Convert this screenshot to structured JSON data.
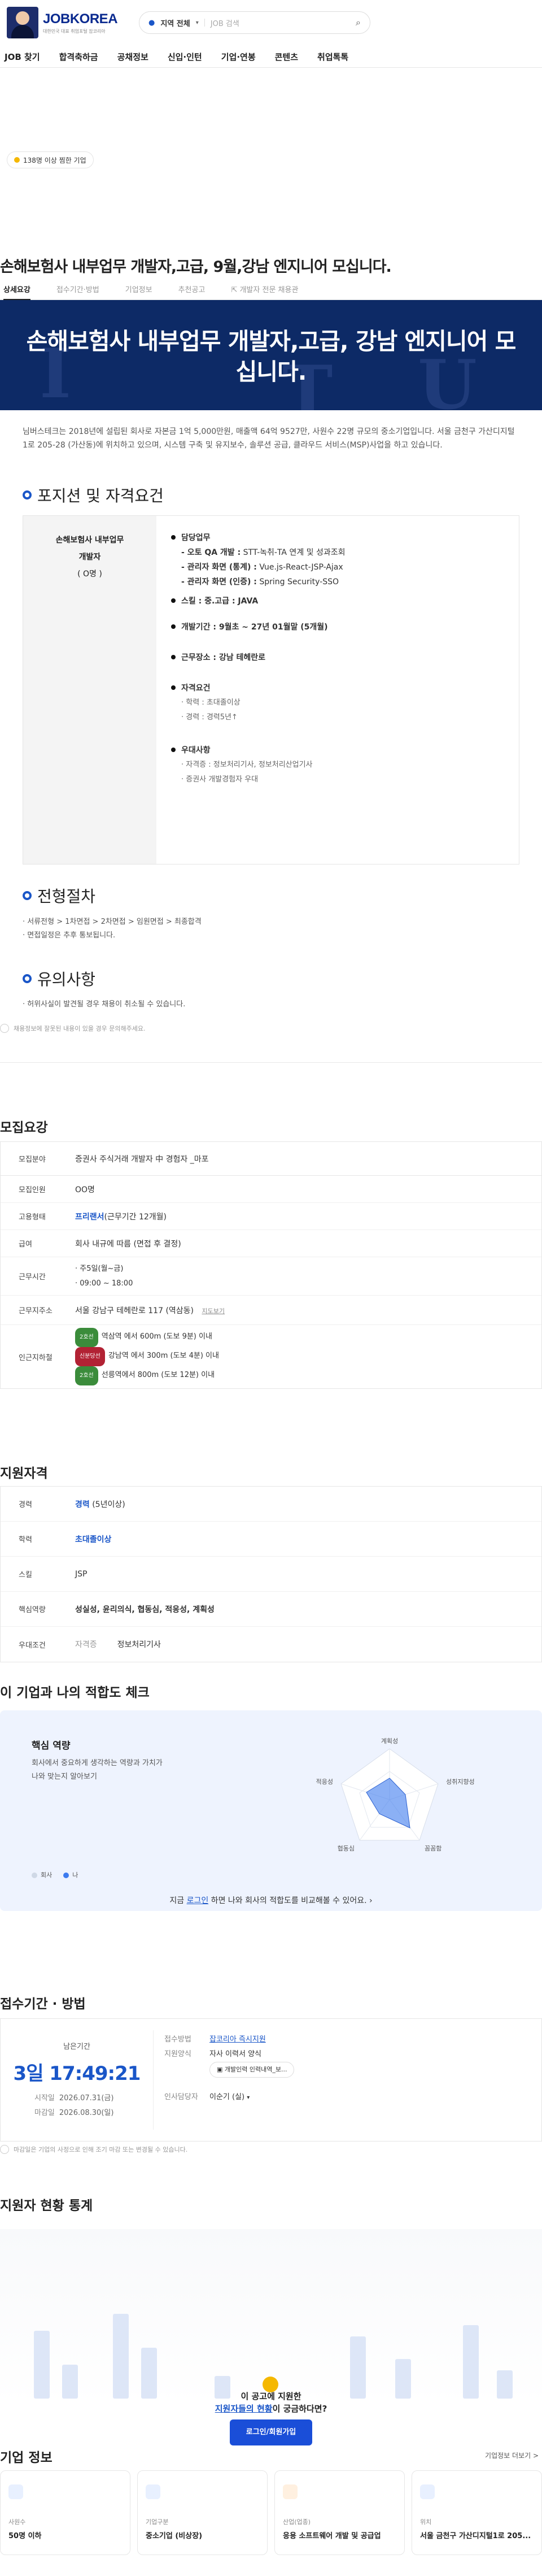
{
  "header": {
    "logo": "JOBKOREA",
    "logo_sub": "대한민국 대표 취업포털 잡코리아",
    "location": "지역 전체",
    "search_placeholder": "JOB 검색",
    "nav": [
      "JOB 찾기",
      "합격축하금",
      "공채정보",
      "신입·인턴",
      "기업·연봉",
      "콘텐츠",
      "취업톡톡"
    ]
  },
  "badge": "138명 이상 찜한 기업",
  "job_title": "손해보험사 내부업무 개발자,고급, 9월,강남 엔지니어 모십니다.",
  "tabs": [
    "상세요강",
    "접수기간·방법",
    "기업정보",
    "추천공고",
    "개발자 전문 채용관"
  ],
  "banner_title": "손해보험사 내부업무 개발자,고급, 강남 엔지니어 모십니다.",
  "intro": "님버스테크는 2018년에 설립된 회사로 자본금 1억 5,000만원, 매출액 64억 9527만, 사원수 22명 규모의 중소기업입니다. 서울 금천구 가산디지털1로 205-28 (가산동)에 위치하고 있으며, 시스템 구축 및 유지보수, 솔루션 공급, 클라우드 서비스(MSP)사업을 하고 있습니다.",
  "position": {
    "heading": "포지션 및 자격요건",
    "left": [
      "손해보험사 내부업무",
      "개발자",
      "( O명 )"
    ],
    "duty_h": "담당업무",
    "duties": [
      {
        "b": "- 오토 QA 개발 :",
        "t": " STT-녹취-TA 연계 및 성과조회"
      },
      {
        "b": "- 관리자 화면 (통계) :",
        "t": " Vue.js-React-JSP-Ajax"
      },
      {
        "b": "- 관리자 화면 (인증) :",
        "t": " Spring Security-SSO"
      }
    ],
    "skill": "스킬 : 중.고급 : JAVA",
    "period": "개발기간 :  9월초 ~ 27년 01월말 (5개월)",
    "place": "근무장소 : 강남 테헤란로",
    "req_h": "자격요건",
    "reqs": [
      "· 학력 : 초대졸이상",
      "· 경력 : 경력5년↑"
    ],
    "pref_h": "우대사항",
    "prefs": [
      "· 자격증 : 정보처리기사, 정보처리산업기사",
      "· 증권사 개발경험자 우대"
    ]
  },
  "process": {
    "heading": "전형절차",
    "lines": [
      "· 서류전형 > 1차면접 > 2차면접 > 임원면접 > 최종합격",
      "· 면접일정은 추후 통보됩니다."
    ]
  },
  "caution": {
    "heading": "유의사항",
    "lines": [
      "· 허위사실이 발견될 경우 채용이 취소될 수 있습니다."
    ]
  },
  "note": "채용정보에 잘못된 내용이 있을 경우 문의해주세요.",
  "recruit": {
    "title": "모집요강",
    "field_k": "모집분야",
    "field_v": "증권사 주식거래 개발자 中 경험자 _마포",
    "count_k": "모집인원",
    "count_v": "OO명",
    "type_k": "고용형태",
    "type_b": "프리랜서",
    "type_v": "(근무기간 12개월)",
    "pay_k": "급여",
    "pay_v": "회사 내규에 따름 (면접 후 결정)",
    "time_k": "근무시간",
    "time_v1": "· 주5일(월~금)",
    "time_v2": "· 09:00 ~ 18:00",
    "addr_k": "근무지주소",
    "addr_v": "서울 강남구 테헤란로 117 (역삼동)",
    "addr_map": "지도보기",
    "sub_k": "인근지하철",
    "subs": [
      {
        "tag": "2호선",
        "t": "역삼역 에서 600m (도보 9분) 이내"
      },
      {
        "tag": "신분당선",
        "t": "강남역 에서 300m (도보 4분) 이내"
      },
      {
        "tag": "2호선",
        "t": "선릉역에서 800m (도보 12분) 이내"
      }
    ]
  },
  "qual": {
    "title": "지원자격",
    "exp_k": "경력",
    "exp_b": "경력",
    "exp_v": " (5년이상)",
    "edu_k": "학력",
    "edu_v": "초대졸이상",
    "skill_k": "스킬",
    "skill_v": "JSP",
    "core_k": "핵심역량",
    "core_v": "성실성, 윤리의식, 협동심, 적응성, 계획성",
    "pref_k": "우대조건",
    "pref_l": "자격증",
    "pref_v": "정보처리기사"
  },
  "fit": {
    "title": "이 기업과 나의 적합도 체크",
    "core": "핵심 역량",
    "desc1": "회사에서 중요하게 생각하는 역량과 가치가",
    "desc2": "나와 맞는지 알아보기",
    "axes": [
      "계획성",
      "성취지향성",
      "꼼꼼함",
      "협동심",
      "적응성"
    ],
    "legend_company": "회사",
    "legend_me": "나",
    "login_pre": "지금 ",
    "login_link": "로그인",
    "login_post": " 하면 나와 회사의 적합도를 비교해볼 수 있어요."
  },
  "receipt": {
    "title": "접수기간 · 방법",
    "left_label": "남은기간",
    "left_time": "3일 17:49:21",
    "start_k": "시작일",
    "start_v": "2026.07.31(금)",
    "end_k": "마감일",
    "end_v": "2026.08.30(일)",
    "method_k": "접수방법",
    "method_v": "잡코리아 즉시지원",
    "form_k": "지원양식",
    "form_v": "자사 이력서 양식",
    "file_v": "개발인력 인력내역_보...",
    "hr_k": "인사담당자",
    "hr_v": "이순기 (실)",
    "note": "마감일은 기업의 사정으로 인해 조기 마감 또는 변경될 수 있습니다."
  },
  "applicant": {
    "title": "지원자 현황 통계",
    "lock1a": "이 공고에 지원한",
    "lock2a": "지원자들의 현황",
    "lock2b": "이 궁금하다면?",
    "btn": "로그인/회원가입"
  },
  "company": {
    "title": "기업 정보",
    "more": "기업정보 더보기 >",
    "cards": [
      {
        "l": "사원수",
        "v": "50명 이하"
      },
      {
        "l": "기업구분",
        "v": "중소기업 (비상장)"
      },
      {
        "l": "산업(업종)",
        "v": "응용 소프트웨어 개발 및 공급업"
      },
      {
        "l": "위치",
        "v": "서울 금천구 가산디지털1로 205..."
      }
    ]
  }
}
